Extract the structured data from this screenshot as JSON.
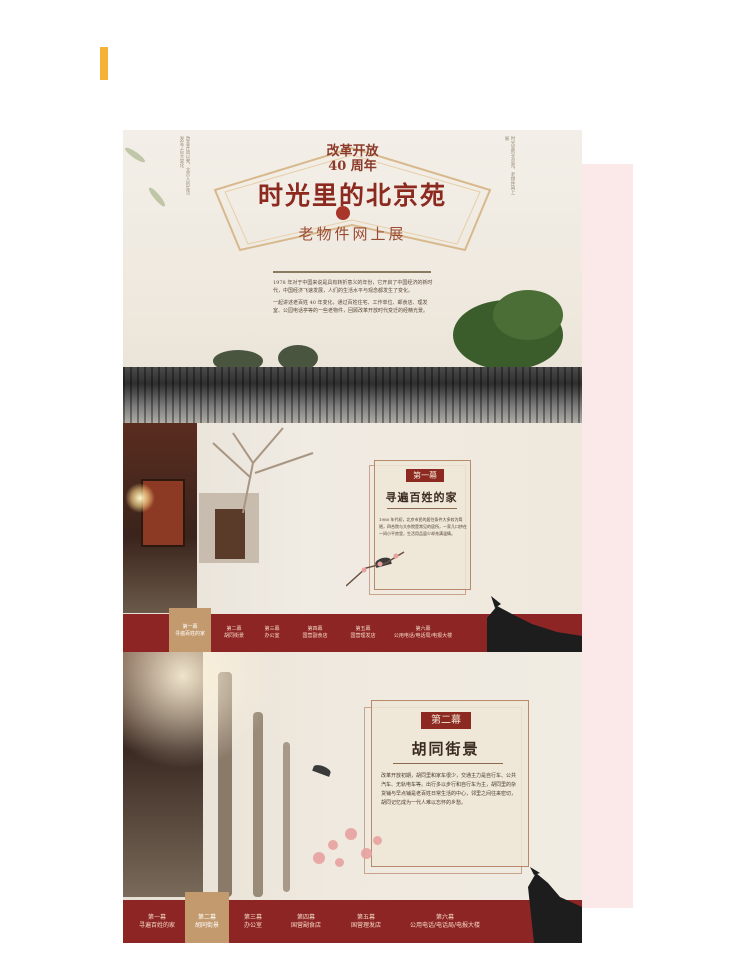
{
  "panel1": {
    "top_line1": "改革开放",
    "top_line2": "40 周年",
    "title": "时光里的北京苑",
    "subtitle": "老物件网上展",
    "intro_p1": "1978 年对于中国来说是具有转折意义的年份，它开启了中国经济的新时代，中国经济飞速发展，人们的生活水平与观念都发生了变化。",
    "intro_p2": "一起讲述老百姓 40 年变化，通过百姓住宅、工作单位、邮食店、理发室、公园电话亭等的一些老物件，回顾改革开放时代变迁的经精光景。",
    "vert_left": "改革开放以来，北京人的生活发生了巨大变化",
    "vert_right": "时光里的北京苑，老物件网上展"
  },
  "panel2": {
    "act_label": "第一幕",
    "act_title": "寻遍百姓的家",
    "act_text": "1980 年代初，北京市民的居住条件大多较为简陋，四合院与大杂院是常见的居所，一家几口挤在一间小平房里，生活用品虽少却充满温情。",
    "nav": [
      {
        "num": "第一幕",
        "label": "寻遍百姓的家"
      },
      {
        "num": "第二幕",
        "label": "胡同街景"
      },
      {
        "num": "第三幕",
        "label": "办公室"
      },
      {
        "num": "第四幕",
        "label": "国营副食店"
      },
      {
        "num": "第五幕",
        "label": "国营理发店"
      },
      {
        "num": "第六幕",
        "label": "公用电话/电话局/电报大楼"
      }
    ]
  },
  "panel3": {
    "act_label": "第二幕",
    "act_title": "胡同街景",
    "act_text": "改革开放初期，胡同里和家车很少，交通主力是自行车、公共汽车、无轨电车等。出行多以步行和自行车为主，胡同里的杂货铺与早点铺是老百姓日常生活的中心，邻里之间往来密切，胡同记忆成为一代人难以忘怀的乡愁。",
    "nav": [
      {
        "num": "第一幕",
        "label": "寻遍百姓的家"
      },
      {
        "num": "第二幕",
        "label": "胡同街景"
      },
      {
        "num": "第三幕",
        "label": "办公室"
      },
      {
        "num": "第四幕",
        "label": "国营副食店"
      },
      {
        "num": "第五幕",
        "label": "国营理发店"
      },
      {
        "num": "第六幕",
        "label": "公用电话/电话局/电报大楼"
      }
    ]
  },
  "colors": {
    "accent": "#f5b335",
    "nav_red": "#8e2525",
    "nav_active": "#c39a6e",
    "pink": "#fbe9e9"
  }
}
